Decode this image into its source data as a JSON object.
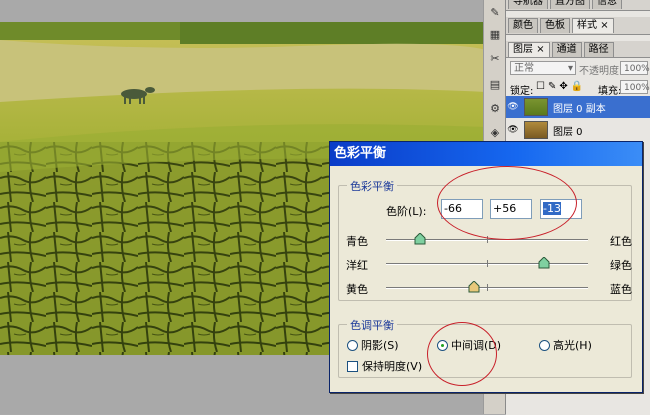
{
  "panels": {
    "top_tabs": [
      "导航器",
      "直方图",
      "信息"
    ],
    "swatch_tabs": [
      "颜色",
      "色板",
      "样式"
    ],
    "layer_tabs": [
      "图层",
      "通道",
      "路径"
    ],
    "blend_mode": "正常",
    "opacity_label": "不透明度:",
    "opacity_value": "100%",
    "lock_label": "锁定:",
    "fill_label": "填充:",
    "fill_value": "100%",
    "layers": [
      {
        "name": "图层 0 副本",
        "selected": true
      },
      {
        "name": "图层 0",
        "selected": false
      }
    ]
  },
  "dialog": {
    "title": "色彩平衡",
    "color_balance_group": "色彩平衡",
    "levels_label": "色阶(L):",
    "levels": [
      "-66",
      "+56",
      "-13"
    ],
    "sliders": [
      {
        "left": "青色",
        "right": "红色",
        "value": -66
      },
      {
        "left": "洋红",
        "right": "绿色",
        "value": 56
      },
      {
        "left": "黄色",
        "right": "蓝色",
        "value": -13
      }
    ],
    "tone_group": "色调平衡",
    "tones": [
      "阴影(S)",
      "中间调(D)",
      "高光(H)"
    ],
    "selected_tone": "中间调(D)",
    "preserve_luminosity": "保持明度(V)",
    "preserve_checked": false
  },
  "colors": {
    "title_bar": "#0a3cc8",
    "highlight_ellipse": "#c8202a",
    "selected_layer": "#3a6fcf"
  }
}
